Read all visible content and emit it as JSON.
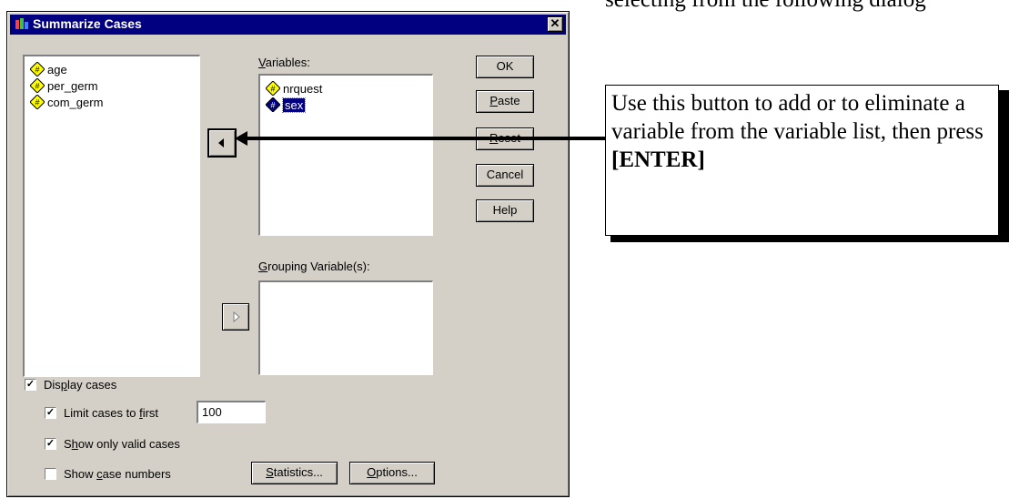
{
  "document": {
    "top_text": "selecting from the following dialog"
  },
  "dialog": {
    "title": "Summarize Cases",
    "close_glyph": "✕",
    "source_list": [
      {
        "name": "age",
        "icon": "numeric-variable-icon"
      },
      {
        "name": "per_germ",
        "icon": "numeric-variable-icon"
      },
      {
        "name": "com_germ",
        "icon": "numeric-variable-icon"
      }
    ],
    "variables_label_u": "V",
    "variables_label_rest": "ariables:",
    "variables_list": [
      {
        "name": "nrquest",
        "icon": "numeric-variable-icon",
        "selected": false
      },
      {
        "name": "sex",
        "icon": "numeric-variable-icon",
        "selected": true
      }
    ],
    "grouping_label_u": "G",
    "grouping_label_rest": "rouping Variable(s):",
    "buttons": {
      "ok": "OK",
      "paste_u": "P",
      "paste_rest": "aste",
      "reset_u": "R",
      "reset_rest": "eset",
      "cancel": "Cancel",
      "help": "Help",
      "statistics_u": "S",
      "statistics_rest": "tatistics...",
      "options_u": "O",
      "options_rest": "ptions..."
    },
    "checkboxes": {
      "display_cases": {
        "pre": "Dis",
        "u": "p",
        "post": "lay cases",
        "checked": true
      },
      "limit_cases": {
        "pre": "Limit cases to ",
        "u": "f",
        "post": "irst",
        "checked": true
      },
      "valid_cases": {
        "pre": "S",
        "u": "h",
        "post": "ow only valid cases",
        "checked": true
      },
      "case_numbers": {
        "pre": "Show ",
        "u": "c",
        "post": "ase numbers",
        "checked": false
      }
    },
    "limit_value": "100",
    "check_glyph": "✓"
  },
  "callout": {
    "text_before": "Use this button to add or to eliminate a variable from the variable list, then press ",
    "text_bold": "[ENTER]"
  },
  "colors": {
    "dialog_bg": "#d4d0c8",
    "titlebar": "#000080",
    "selection": "#000080",
    "icon_yellow": "#ffff00"
  }
}
